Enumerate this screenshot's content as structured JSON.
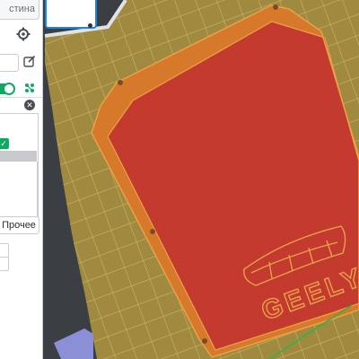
{
  "panel": {
    "plate_tab_label": "стина",
    "other_button_label": "Прочее"
  },
  "viewport": {
    "bed_label": "GEELY",
    "colors": {
      "bed": "#a08a3f",
      "bed_grid": "#c8b46a",
      "model_fill": "#c53a2e",
      "model_wall": "#d7792a",
      "model_outline": "#e7a24a",
      "accent": "#1d86d9",
      "active_green": "#11a864"
    }
  }
}
